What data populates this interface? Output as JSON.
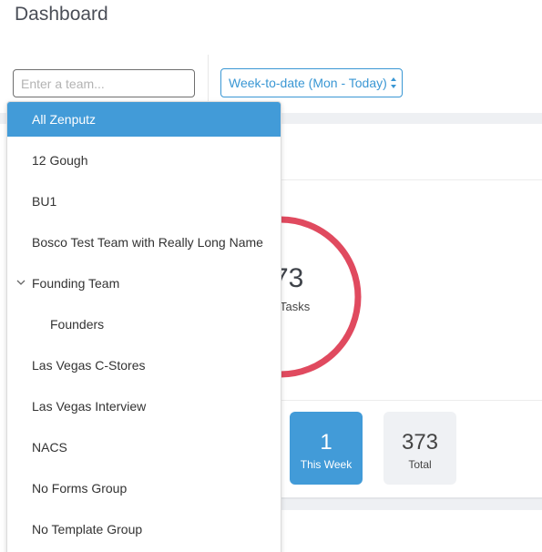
{
  "header": {
    "title": "Dashboard"
  },
  "filters": {
    "team_placeholder": "Enter a team...",
    "period_value": "Week-to-date (Mon - Today)"
  },
  "summary": {
    "number_visible": "73",
    "label_visible": ": Tasks",
    "stats": [
      {
        "value": "1",
        "label": "This Week"
      },
      {
        "value": "373",
        "label": "Total"
      }
    ]
  },
  "team_dropdown": {
    "items": [
      {
        "label": "All Zenputz",
        "selected": true
      },
      {
        "label": "12 Gough"
      },
      {
        "label": "BU1"
      },
      {
        "label": "Bosco Test Team with Really Long Name"
      },
      {
        "label": "Founding Team",
        "expanded": true
      },
      {
        "label": "Founders",
        "child": true
      },
      {
        "label": "Las Vegas C-Stores"
      },
      {
        "label": "Las Vegas Interview"
      },
      {
        "label": "NACS"
      },
      {
        "label": "No Forms Group"
      },
      {
        "label": "No Template Group"
      }
    ]
  },
  "colors": {
    "accent": "#429bd8",
    "donut": "#e04a5f",
    "select_border": "#3a97d4"
  }
}
